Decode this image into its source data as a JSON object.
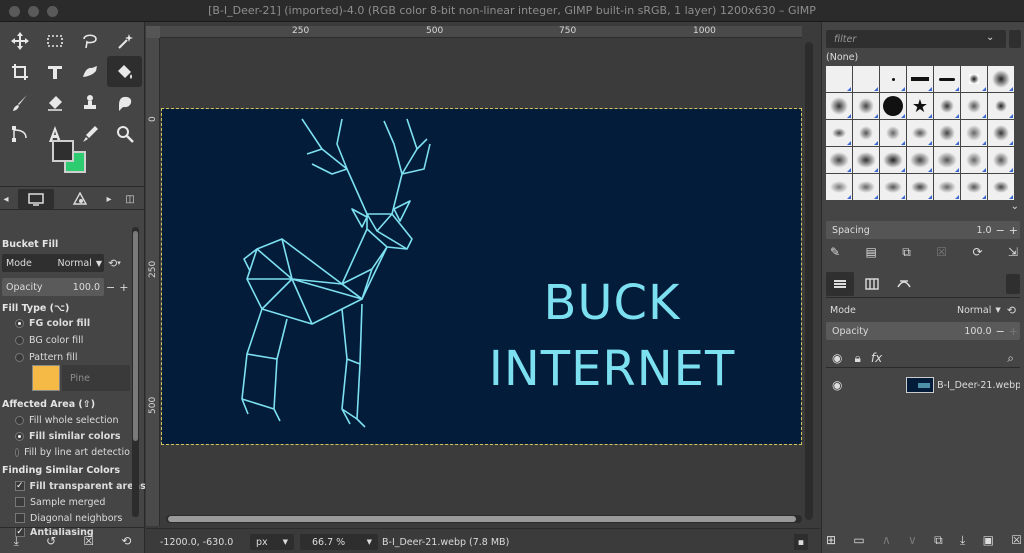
{
  "window": {
    "title": "[B-I_Deer-21] (imported)-4.0 (RGB color 8-bit non-linear integer, GIMP built-in sRGB, 1 layer) 1200x630 – GIMP"
  },
  "toolbox": {
    "tools": [
      "move",
      "rect-select",
      "free-select",
      "fuzzy-select",
      "crop",
      "transform",
      "warp",
      "bucket-fill",
      "paintbrush",
      "eraser",
      "clone",
      "smudge",
      "path",
      "text",
      "color-picker",
      "zoom"
    ],
    "active_tool": "bucket-fill",
    "fg_color": "#2f2f2f",
    "bg_color": "#2ecc71"
  },
  "tool_options": {
    "title": "Bucket Fill",
    "mode_label": "Mode",
    "mode_value": "Normal",
    "opacity_label": "Opacity",
    "opacity_value": "100.0",
    "fill_type_label": "Fill Type  (⌥)",
    "fill_fg": "FG color fill",
    "fill_bg": "BG color fill",
    "fill_pattern": "Pattern fill",
    "pattern_name": "Pine",
    "affected_label": "Affected Area  (⇧)",
    "area_whole": "Fill whole selection",
    "area_similar": "Fill similar colors",
    "area_line": "Fill by line art detectio",
    "finding_label": "Finding Similar Colors",
    "fill_transparent": "Fill transparent areas",
    "sample_merged": "Sample merged",
    "diagonal": "Diagonal neighbors",
    "antialiasing": "Antialiasing"
  },
  "ruler": {
    "top": [
      "250",
      "500",
      "750",
      "1000"
    ],
    "left": [
      "0",
      "250",
      "500"
    ]
  },
  "image": {
    "line1": "BUCK",
    "line2": "INTERNET",
    "bg_color": "#031c3a",
    "accent": "#7de0f0"
  },
  "status": {
    "coords": "-1200.0, -630.0",
    "unit": "px",
    "zoom": "66.7 %",
    "file": "B-I_Deer-21.webp (7.8 MB)"
  },
  "brushes": {
    "filter_placeholder": "filter",
    "selected": "(None)",
    "spacing_label": "Spacing",
    "spacing_value": "1.0"
  },
  "layers": {
    "mode_label": "Mode",
    "mode_value": "Normal",
    "opacity_label": "Opacity",
    "opacity_value": "100.0",
    "layer_name": "B-I_Deer-21.webp"
  }
}
